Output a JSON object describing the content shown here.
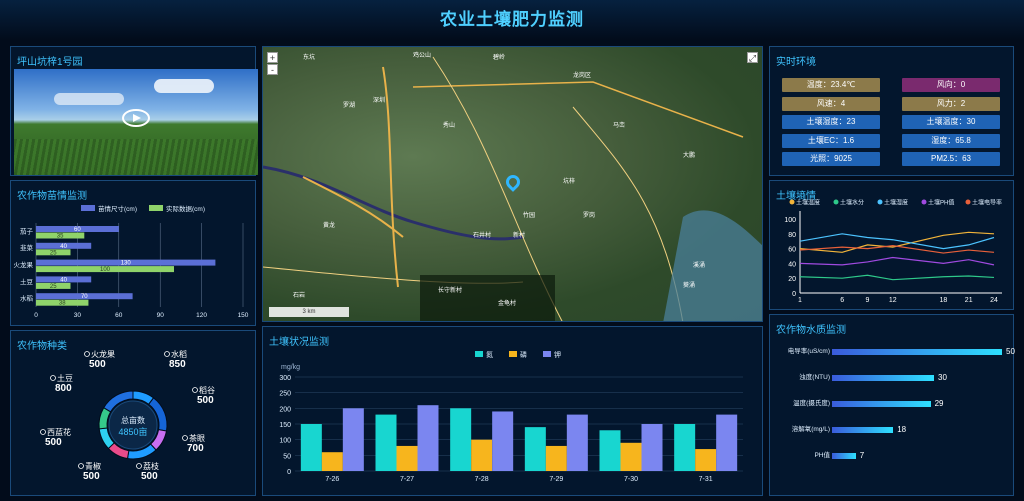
{
  "header": {
    "title": "农业土壤肥力监测"
  },
  "video_panel": {
    "title": "坪山坑梓1号园"
  },
  "map_panel": {
    "zoom_in": "+",
    "zoom_out": "-",
    "fullscreen_label": "⤢",
    "scale_label": "3 km",
    "places": [
      "鸡公山",
      "东坑",
      "深圳",
      "碧岭",
      "龙岗区",
      "坑梓",
      "石井村",
      "秀山",
      "黄龙",
      "大鹏",
      "罗湖",
      "新村",
      "竹园",
      "金龟村",
      "长守新村",
      "马峦",
      "葵涌",
      "溪涌",
      "罗岗",
      "石岩"
    ]
  },
  "env_panel": {
    "title": "实时环境",
    "chips": [
      {
        "text": "温度：23.4℃",
        "color": "#8c7a4a"
      },
      {
        "text": "风向：0",
        "color": "#7a2a6e"
      },
      {
        "text": "风速：4",
        "color": "#8c7a4a"
      },
      {
        "text": "风力：2",
        "color": "#8c7a4a"
      },
      {
        "text": "土壤湿度：23",
        "color": "#1f63b5"
      },
      {
        "text": "土壤温度：30",
        "color": "#1f63b5"
      },
      {
        "text": "土壤EC：1.6",
        "color": "#1f63b5"
      },
      {
        "text": "湿度：65.8",
        "color": "#1f63b5"
      },
      {
        "text": "光照：9025",
        "color": "#1f63b5"
      },
      {
        "text": "PM2.5：63",
        "color": "#1f63b5"
      }
    ]
  },
  "chart_data": [
    {
      "id": "seedling",
      "title": "农作物苗情监测",
      "type": "bar",
      "orientation": "horizontal",
      "categories": [
        "茄子",
        "韭菜",
        "火龙果",
        "土豆",
        "水稻"
      ],
      "series": [
        {
          "name": "苗情尺寸(cm)",
          "color": "#5b6fd6",
          "values": [
            60,
            40,
            130,
            40,
            70
          ]
        },
        {
          "name": "实际数据(cm)",
          "color": "#8fd36a",
          "values": [
            35,
            25,
            100,
            25,
            38
          ]
        }
      ],
      "xticks": [
        "0",
        "30",
        "60",
        "90",
        "120",
        "150"
      ],
      "xlim": [
        0,
        150
      ]
    },
    {
      "id": "soil_trend",
      "title": "土壤墒情",
      "type": "line",
      "x": [
        1,
        6,
        9,
        12,
        18,
        21,
        24
      ],
      "xticks": [
        "1",
        "6",
        "9",
        "12",
        "18",
        "21",
        "24"
      ],
      "yticks": [
        "0",
        "20",
        "40",
        "60",
        "80",
        "100"
      ],
      "ylim": [
        0,
        100
      ],
      "series": [
        {
          "name": "土壤温度",
          "color": "#f2b43a",
          "values": [
            60,
            55,
            65,
            62,
            78,
            82,
            80
          ]
        },
        {
          "name": "土壤水分",
          "color": "#2ec98a",
          "values": [
            22,
            20,
            24,
            18,
            22,
            23,
            21
          ]
        },
        {
          "name": "土壤湿度",
          "color": "#4cc3ff",
          "values": [
            70,
            80,
            75,
            72,
            60,
            65,
            75
          ]
        },
        {
          "name": "土壤PH值",
          "color": "#a04ae0",
          "values": [
            40,
            38,
            42,
            48,
            40,
            45,
            38
          ]
        },
        {
          "name": "土壤电导率",
          "color": "#e8603a",
          "values": [
            58,
            62,
            60,
            64,
            54,
            58,
            55
          ]
        }
      ]
    },
    {
      "id": "crop_types",
      "title": "农作物种类",
      "type": "pie",
      "center_label": "总亩数",
      "center_value": "4850亩",
      "slices": [
        {
          "name": "火龙果",
          "value": 500,
          "color": "#1f9cff"
        },
        {
          "name": "水稻",
          "value": 850,
          "color": "#1565d8"
        },
        {
          "name": "稻谷",
          "value": 500,
          "color": "#c86ef0"
        },
        {
          "name": "茶眼",
          "value": 700,
          "color": "#1f9cff"
        },
        {
          "name": "荔枝",
          "value": 500,
          "color": "#e94b8a"
        },
        {
          "name": "青椒",
          "value": 500,
          "color": "#2ed0f0"
        },
        {
          "name": "西蓝花",
          "value": 500,
          "color": "#35c98a"
        },
        {
          "name": "土豆",
          "value": 800,
          "color": "#1f6fe0"
        }
      ]
    },
    {
      "id": "soil_status",
      "title": "土壤状况监测",
      "type": "bar",
      "ylabel": "mg/kg",
      "categories": [
        "7-26",
        "7-27",
        "7-28",
        "7-29",
        "7-30",
        "7-31"
      ],
      "yticks": [
        "0",
        "50",
        "100",
        "150",
        "200",
        "250",
        "300"
      ],
      "ylim": [
        0,
        300
      ],
      "series": [
        {
          "name": "氮",
          "color": "#18d6d0",
          "values": [
            150,
            180,
            200,
            140,
            130,
            150
          ]
        },
        {
          "name": "磷",
          "color": "#f7b51d",
          "values": [
            60,
            80,
            100,
            80,
            90,
            70
          ]
        },
        {
          "name": "钾",
          "color": "#7b86f0",
          "values": [
            200,
            210,
            190,
            180,
            150,
            180
          ]
        }
      ]
    },
    {
      "id": "water_quality",
      "title": "农作物水质监测",
      "type": "bar",
      "orientation": "horizontal",
      "categories": [
        "电导率(uS/cm)",
        "浊度(NTU)",
        "温度(摄氏度)",
        "溶解氧(mg/L)",
        "PH值"
      ],
      "values": [
        50,
        30,
        29,
        18,
        7
      ],
      "xlim": [
        0,
        50
      ]
    }
  ]
}
